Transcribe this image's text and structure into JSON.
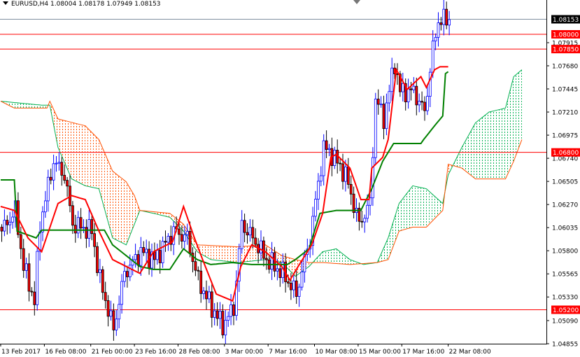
{
  "header": {
    "symbol": "EURUSD,H4",
    "open": "1.08004",
    "high": "1.08178",
    "low": "1.07949",
    "close": "1.08153"
  },
  "chart_data": {
    "type": "candlestick",
    "title": "EURUSD,H4",
    "ylim": [
      1.048,
      1.0835
    ],
    "bars_visible": 192,
    "last_price": 1.08153,
    "y_ticks": [
      "1.07915",
      "1.07680",
      "1.07445",
      "1.07210",
      "1.06975",
      "1.06740",
      "1.06505",
      "1.06270",
      "1.06035",
      "1.05800",
      "1.05565",
      "1.05330",
      "1.05090",
      "1.04855"
    ],
    "x_ticks": [
      {
        "bar": 0,
        "label": "13 Feb 2017"
      },
      {
        "bar": 16,
        "label": "16 Feb 08:00"
      },
      {
        "bar": 33,
        "label": "21 Feb 00:00"
      },
      {
        "bar": 49,
        "label": "23 Feb 16:00"
      },
      {
        "bar": 65,
        "label": "28 Feb 08:00"
      },
      {
        "bar": 82,
        "label": "3 Mar 00:00"
      },
      {
        "bar": 98,
        "label": "7 Mar 16:00"
      },
      {
        "bar": 115,
        "label": "10 Mar 08:00"
      },
      {
        "bar": 131,
        "label": "15 Mar 00:00"
      },
      {
        "bar": 147,
        "label": "17 Mar 16:00"
      },
      {
        "bar": 164,
        "label": "22 Mar 08:00"
      }
    ],
    "levels": [
      {
        "price": 1.08,
        "label": "1.08000",
        "color": "#ff0000"
      },
      {
        "price": 1.0785,
        "label": "1.07850",
        "color": "#ff0000"
      },
      {
        "price": 1.068,
        "label": "1.06800",
        "color": "#ff0000"
      },
      {
        "price": 1.052,
        "label": "1.05200",
        "color": "#ff0000"
      }
    ],
    "bid_label": "1.08153",
    "price_path": [
      [
        0,
        1.06
      ],
      [
        5,
        1.0621
      ],
      [
        8,
        1.0564
      ],
      [
        12,
        1.0529
      ],
      [
        14,
        1.0607
      ],
      [
        19,
        1.0671
      ],
      [
        23,
        1.0657
      ],
      [
        26,
        1.0607
      ],
      [
        33,
        1.06
      ],
      [
        36,
        1.055
      ],
      [
        41,
        1.05
      ],
      [
        45,
        1.0557
      ],
      [
        51,
        1.0579
      ],
      [
        56,
        1.0571
      ],
      [
        63,
        1.06
      ],
      [
        68,
        1.0593
      ],
      [
        72,
        1.055
      ],
      [
        77,
        1.0522
      ],
      [
        81,
        1.0504
      ],
      [
        85,
        1.0522
      ],
      [
        88,
        1.0607
      ],
      [
        92,
        1.0593
      ],
      [
        97,
        1.0571
      ],
      [
        103,
        1.0557
      ],
      [
        108,
        1.0536
      ],
      [
        113,
        1.0593
      ],
      [
        118,
        1.0685
      ],
      [
        121,
        1.0678
      ],
      [
        126,
        1.0657
      ],
      [
        131,
        1.0607
      ],
      [
        135,
        1.0628
      ],
      [
        137,
        1.0735
      ],
      [
        140,
        1.0714
      ],
      [
        144,
        1.0771
      ],
      [
        146,
        1.0742
      ],
      [
        151,
        1.0742
      ],
      [
        155,
        1.0721
      ],
      [
        158,
        1.0785
      ],
      [
        160,
        1.0814
      ],
      [
        164,
        1.08153
      ]
    ],
    "tenkan": [
      [
        0,
        1.0625
      ],
      [
        5,
        1.0621
      ],
      [
        10,
        1.0593
      ],
      [
        15,
        1.0579
      ],
      [
        21,
        1.0628
      ],
      [
        26,
        1.0636
      ],
      [
        31,
        1.0632
      ],
      [
        36,
        1.06
      ],
      [
        41,
        1.0571
      ],
      [
        46,
        1.0564
      ],
      [
        51,
        1.0557
      ],
      [
        56,
        1.0579
      ],
      [
        63,
        1.0589
      ],
      [
        67,
        1.0625
      ],
      [
        71,
        1.0593
      ],
      [
        74,
        1.0571
      ],
      [
        79,
        1.0536
      ],
      [
        85,
        1.0529
      ],
      [
        88,
        1.0564
      ],
      [
        92,
        1.0586
      ],
      [
        97,
        1.0579
      ],
      [
        103,
        1.0564
      ],
      [
        106,
        1.055
      ],
      [
        109,
        1.0564
      ],
      [
        114,
        1.0586
      ],
      [
        118,
        1.0618
      ],
      [
        121,
        1.0675
      ],
      [
        123,
        1.0678
      ],
      [
        128,
        1.0664
      ],
      [
        132,
        1.0632
      ],
      [
        135,
        1.0632
      ],
      [
        136,
        1.0664
      ],
      [
        140,
        1.0675
      ],
      [
        142,
        1.0693
      ],
      [
        145,
        1.0764
      ],
      [
        149,
        1.0744
      ],
      [
        154,
        1.0757
      ],
      [
        156,
        1.0746
      ],
      [
        159,
        1.0764
      ],
      [
        161,
        1.0767
      ],
      [
        164,
        1.0767
      ]
    ],
    "kijun": [
      [
        0,
        1.0652
      ],
      [
        5,
        1.0652
      ],
      [
        6,
        1.06
      ],
      [
        13,
        1.0593
      ],
      [
        15,
        1.0601
      ],
      [
        38,
        1.0601
      ],
      [
        41,
        1.0586
      ],
      [
        51,
        1.0564
      ],
      [
        56,
        1.0561
      ],
      [
        62,
        1.0561
      ],
      [
        67,
        1.0582
      ],
      [
        72,
        1.0571
      ],
      [
        77,
        1.0566
      ],
      [
        85,
        1.0568
      ],
      [
        92,
        1.0566
      ],
      [
        105,
        1.0566
      ],
      [
        108,
        1.0571
      ],
      [
        113,
        1.0582
      ],
      [
        117,
        1.0618
      ],
      [
        123,
        1.0621
      ],
      [
        132,
        1.0621
      ],
      [
        136,
        1.0643
      ],
      [
        140,
        1.0671
      ],
      [
        144,
        1.0689
      ],
      [
        154,
        1.0689
      ],
      [
        155,
        1.0693
      ],
      [
        159,
        1.0707
      ],
      [
        162,
        1.0717
      ],
      [
        163,
        1.076
      ],
      [
        164,
        1.0762
      ]
    ],
    "span_a": [
      [
        0,
        1.0732
      ],
      [
        15,
        1.0728
      ],
      [
        18,
        1.0728
      ],
      [
        21,
        1.0685
      ],
      [
        26,
        1.0653
      ],
      [
        31,
        1.0646
      ],
      [
        36,
        1.0643
      ],
      [
        41,
        1.0593
      ],
      [
        46,
        1.0586
      ],
      [
        51,
        1.0621
      ],
      [
        56,
        1.0618
      ],
      [
        62,
        1.0614
      ],
      [
        67,
        1.06
      ],
      [
        72,
        1.0579
      ],
      [
        77,
        1.0571
      ],
      [
        87,
        1.0568
      ],
      [
        97,
        1.0571
      ],
      [
        103,
        1.0568
      ],
      [
        108,
        1.0554
      ],
      [
        113,
        1.0564
      ],
      [
        118,
        1.0579
      ],
      [
        123,
        1.0582
      ],
      [
        128,
        1.0571
      ],
      [
        133,
        1.0566
      ],
      [
        138,
        1.0568
      ],
      [
        142,
        1.0593
      ],
      [
        146,
        1.0628
      ],
      [
        151,
        1.0646
      ],
      [
        156,
        1.0643
      ],
      [
        162,
        1.0628
      ],
      [
        164,
        1.0657
      ],
      [
        169,
        1.0685
      ],
      [
        174,
        1.071
      ],
      [
        179,
        1.0721
      ],
      [
        185,
        1.0725
      ],
      [
        188,
        1.0757
      ],
      [
        191,
        1.0764
      ]
    ],
    "span_b": [
      [
        0,
        1.0732
      ],
      [
        5,
        1.0725
      ],
      [
        17,
        1.0725
      ],
      [
        18,
        1.0732
      ],
      [
        21,
        1.0714
      ],
      [
        31,
        1.0707
      ],
      [
        36,
        1.0693
      ],
      [
        41,
        1.0661
      ],
      [
        46,
        1.065
      ],
      [
        49,
        1.0636
      ],
      [
        51,
        1.0621
      ],
      [
        62,
        1.0618
      ],
      [
        67,
        1.0607
      ],
      [
        72,
        1.0586
      ],
      [
        87,
        1.0584
      ],
      [
        97,
        1.0586
      ],
      [
        103,
        1.0575
      ],
      [
        108,
        1.0571
      ],
      [
        113,
        1.0568
      ],
      [
        118,
        1.0568
      ],
      [
        128,
        1.0566
      ],
      [
        138,
        1.0568
      ],
      [
        142,
        1.0571
      ],
      [
        146,
        1.06
      ],
      [
        151,
        1.0604
      ],
      [
        156,
        1.0604
      ],
      [
        162,
        1.0621
      ],
      [
        164,
        1.0668
      ],
      [
        169,
        1.0664
      ],
      [
        174,
        1.0653
      ],
      [
        179,
        1.0653
      ],
      [
        185,
        1.0653
      ],
      [
        188,
        1.0671
      ],
      [
        191,
        1.0693
      ]
    ],
    "colors": {
      "bull": "#0000ff",
      "bear": "#ff0000",
      "tenkan": "#ff0000",
      "kijun": "#008000",
      "cloud_bull": "#00b050",
      "cloud_bear": "#ff5000",
      "grid_axis": "#000000",
      "bid_line": "#8090a0"
    }
  }
}
